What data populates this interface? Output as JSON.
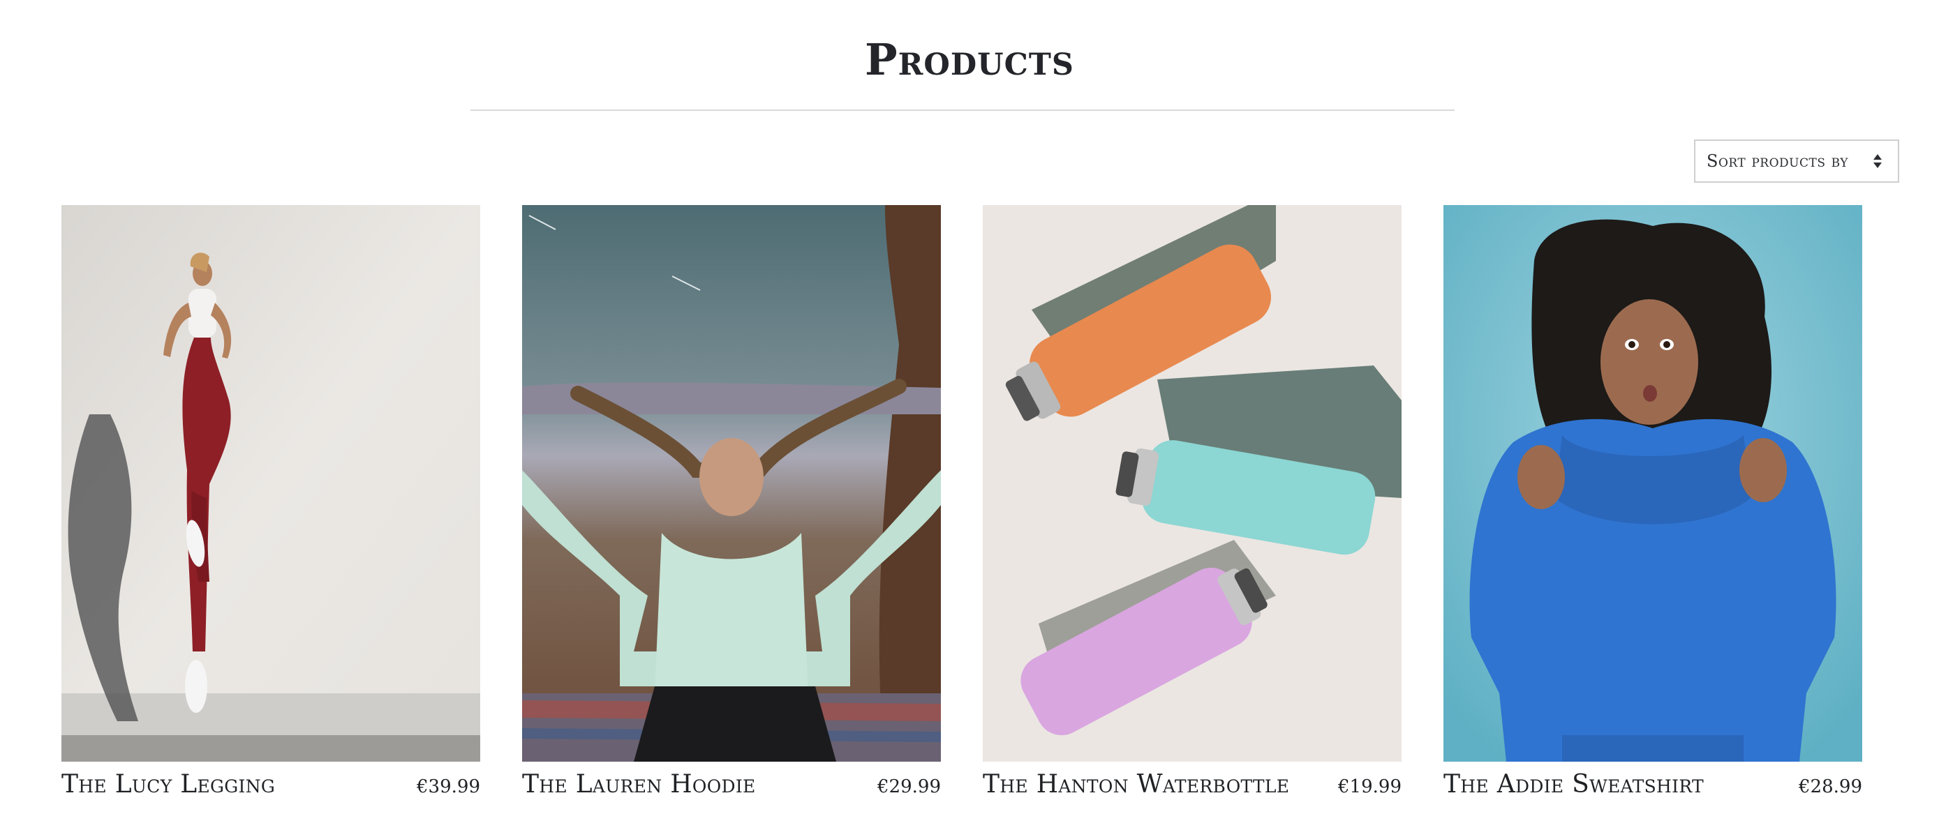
{
  "page": {
    "title": "Products"
  },
  "sort": {
    "label": "Sort products by",
    "icon": "sort-arrows-icon"
  },
  "products": [
    {
      "name": "The Lucy Legging",
      "price": "€39.99"
    },
    {
      "name": "The Lauren Hoodie",
      "price": "€29.99"
    },
    {
      "name": "The Hanton Waterbottle",
      "price": "€19.99"
    },
    {
      "name": "The Addie Sweatshirt",
      "price": "€28.99"
    }
  ],
  "colors": {
    "text": "#1f2124",
    "rule": "#d9d9d9",
    "border": "#cfcfcf"
  }
}
